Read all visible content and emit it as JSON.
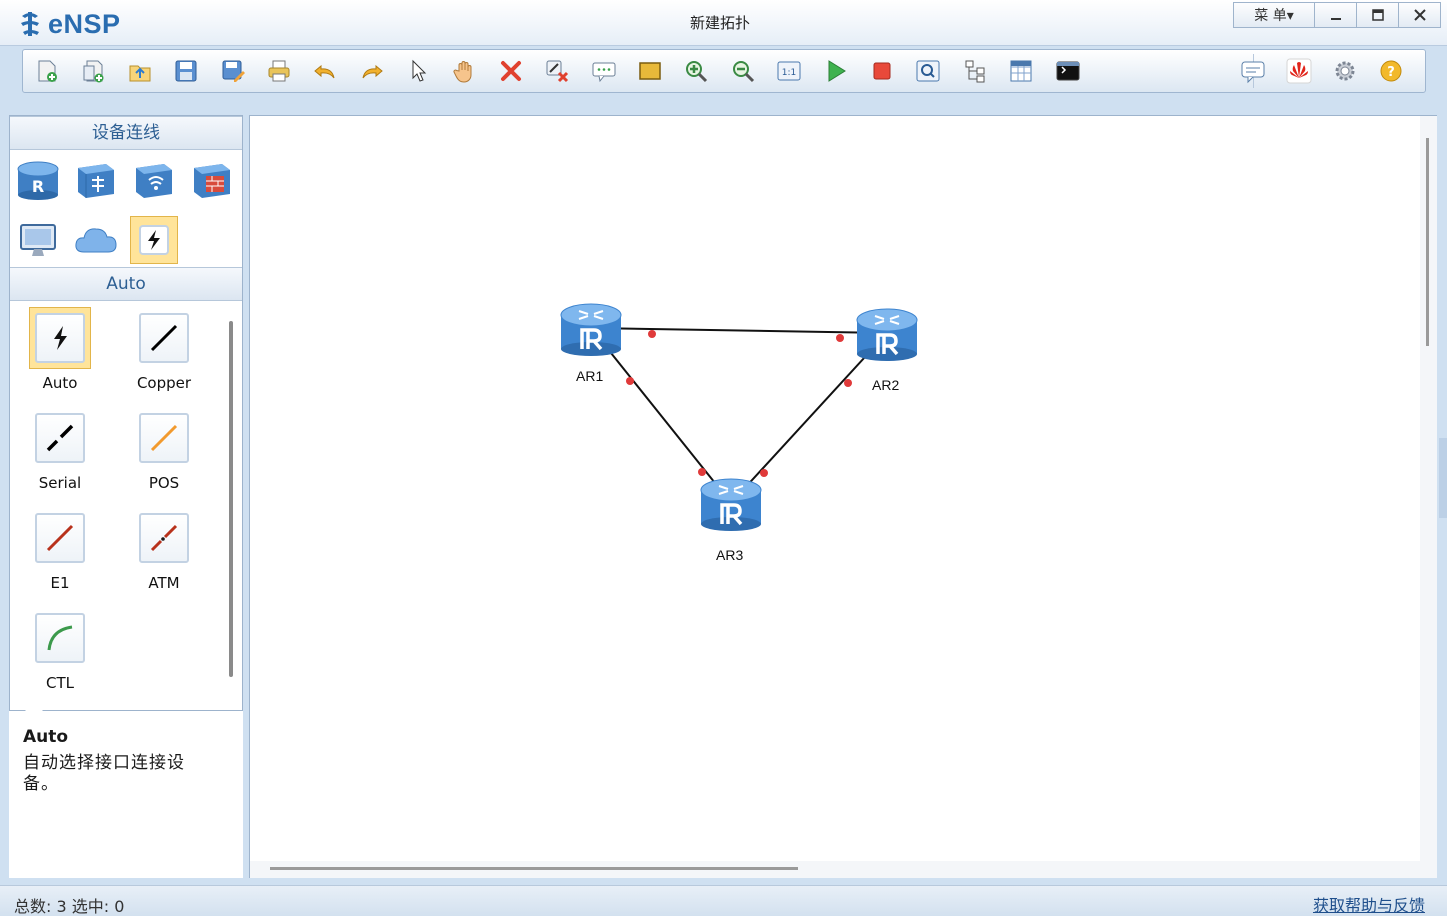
{
  "app": {
    "name": "eNSP",
    "window_title": "新建拓扑",
    "menu_label": "菜 单▾"
  },
  "window_controls": [
    {
      "name": "minimize",
      "glyph": "—"
    },
    {
      "name": "maximize",
      "glyph": "☐"
    },
    {
      "name": "close",
      "glyph": "✕"
    }
  ],
  "toolbar": {
    "left_icons": [
      "new-topology-icon",
      "new-example-icon",
      "open-icon",
      "save-icon",
      "save-as-icon",
      "print-icon",
      "undo-icon",
      "redo-icon",
      "select-pointer-icon",
      "hand-pan-icon",
      "delete-icon",
      "delete-link-icon",
      "text-annotation-icon",
      "rectangle-icon",
      "zoom-in-icon",
      "zoom-out-icon",
      "fit-view-icon",
      "start-device-icon",
      "stop-device-icon",
      "capture-icon",
      "topology-tree-icon",
      "grid-icon",
      "terminal-icon"
    ],
    "right_icons": [
      "forum-icon",
      "huawei-icon",
      "settings-gear-icon",
      "help-icon"
    ]
  },
  "left_panel": {
    "device_header": "设备连线",
    "device_categories": [
      {
        "name": "router",
        "selected": false
      },
      {
        "name": "switch",
        "selected": false
      },
      {
        "name": "wireless",
        "selected": false
      },
      {
        "name": "firewall",
        "selected": false
      },
      {
        "name": "pc",
        "selected": false
      },
      {
        "name": "cloud",
        "selected": false
      },
      {
        "name": "cable",
        "selected": true
      }
    ],
    "cable_header": "Auto",
    "cables": [
      {
        "label": "Auto",
        "selected": true,
        "color": "#000000",
        "style": "auto"
      },
      {
        "label": "Copper",
        "selected": false,
        "color": "#000000",
        "style": "solid"
      },
      {
        "label": "Serial",
        "selected": false,
        "color": "#000000",
        "style": "serial"
      },
      {
        "label": "POS",
        "selected": false,
        "color": "#f29a2e",
        "style": "solid"
      },
      {
        "label": "E1",
        "selected": false,
        "color": "#b8321c",
        "style": "solid"
      },
      {
        "label": "ATM",
        "selected": false,
        "color": "#b8321c",
        "style": "serial"
      },
      {
        "label": "CTL",
        "selected": false,
        "color": "#3c9a4c",
        "style": "curve"
      }
    ],
    "description": {
      "title": "Auto",
      "text": "自动选择接口连接设备。"
    }
  },
  "topology": {
    "nodes": [
      {
        "id": "AR1",
        "label": "AR1"
      },
      {
        "id": "AR2",
        "label": "AR2"
      },
      {
        "id": "AR3",
        "label": "AR3"
      }
    ],
    "links": [
      {
        "from": "AR1",
        "to": "AR2"
      },
      {
        "from": "AR1",
        "to": "AR3"
      },
      {
        "from": "AR2",
        "to": "AR3"
      }
    ],
    "link_color": "#111111",
    "port_color": "#e03a3a",
    "router_color": "#3f8fd9"
  },
  "status": {
    "text": "总数: 3 选中: 0",
    "help_link": "获取帮助与反馈"
  }
}
